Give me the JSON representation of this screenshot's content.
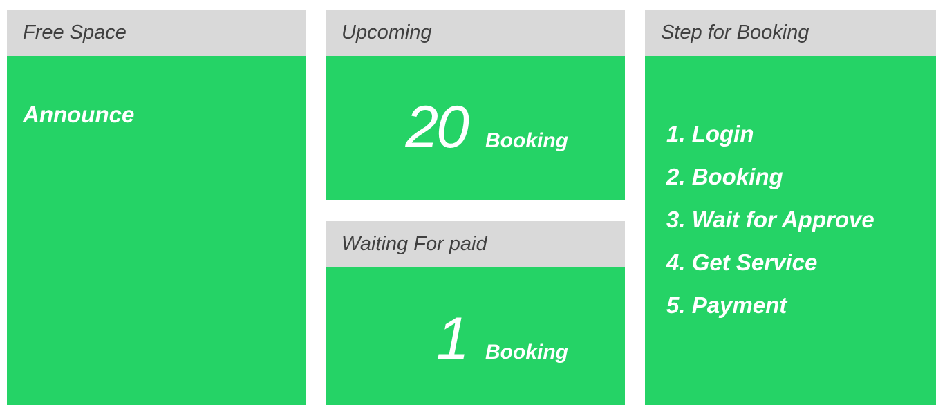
{
  "colors": {
    "header_bg": "#d9d9d9",
    "header_text": "#404040",
    "body_bg": "#25d366",
    "body_text": "#ffffff"
  },
  "free_space": {
    "title": "Free Space",
    "announce": "Announce"
  },
  "upcoming": {
    "title": "Upcoming",
    "count": "20",
    "unit": "Booking"
  },
  "waiting": {
    "title": "Waiting For paid",
    "count": "1",
    "unit": "Booking"
  },
  "steps": {
    "title": "Step for Booking",
    "items": [
      "1. Login",
      "2. Booking",
      "3. Wait for Approve",
      "4. Get Service",
      "5. Payment"
    ]
  }
}
